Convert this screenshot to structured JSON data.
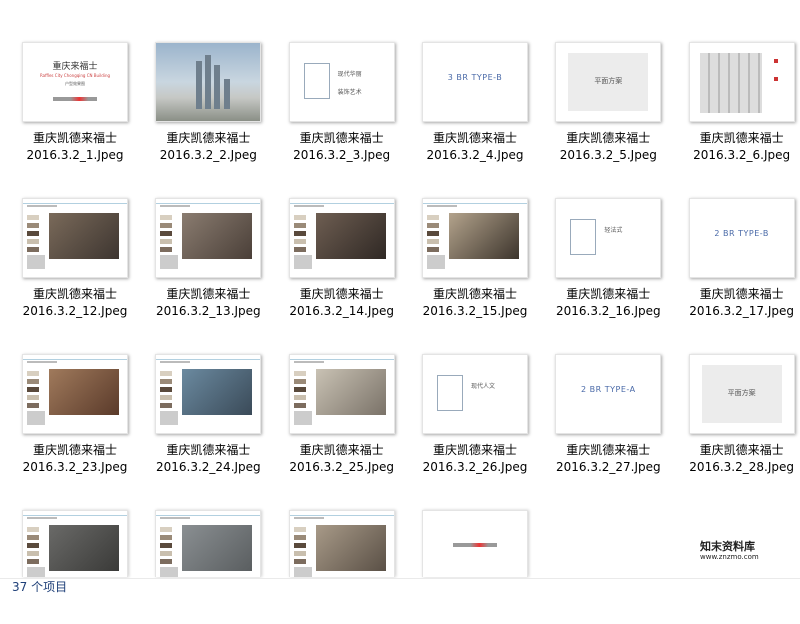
{
  "files": [
    {
      "line1": "重庆凯德来福士",
      "line2": "2016.3.2_1.Jpeg",
      "kind": "cover",
      "cover_title": "重庆来福士",
      "cover_sub": "Raffles City Chongqing CN Building",
      "cover_sub2": "户型效果图"
    },
    {
      "line1": "重庆凯德来福士",
      "line2": "2016.3.2_2.Jpeg",
      "kind": "sky"
    },
    {
      "line1": "重庆凯德来福士",
      "line2": "2016.3.2_3.Jpeg",
      "kind": "txt",
      "a": "现代华丽",
      "b": "装饰艺术"
    },
    {
      "line1": "重庆凯德来福士",
      "line2": "2016.3.2_4.Jpeg",
      "kind": "title",
      "title": "3 BR TYPE-B"
    },
    {
      "line1": "重庆凯德来福士",
      "line2": "2016.3.2_5.Jpeg",
      "kind": "plan",
      "title": "平面方案"
    },
    {
      "line1": "重庆凯德来福士",
      "line2": "2016.3.2_6.Jpeg",
      "kind": "floor"
    },
    {
      "line1": "重庆凯德来福士",
      "line2": "2016.3.2_12.Jpeg",
      "kind": "room",
      "c1": "#7a6a5a",
      "c2": "#3d3530"
    },
    {
      "line1": "重庆凯德来福士",
      "line2": "2016.3.2_13.Jpeg",
      "kind": "room",
      "c1": "#8a7c70",
      "c2": "#4a3f38"
    },
    {
      "line1": "重庆凯德来福士",
      "line2": "2016.3.2_14.Jpeg",
      "kind": "room",
      "c1": "#6e5e52",
      "c2": "#2f2824"
    },
    {
      "line1": "重庆凯德来福士",
      "line2": "2016.3.2_15.Jpeg",
      "kind": "room",
      "c1": "#b3a38c",
      "c2": "#3c342c"
    },
    {
      "line1": "重庆凯德来福士",
      "line2": "2016.3.2_16.Jpeg",
      "kind": "txt",
      "a": "轻法式",
      "b": ""
    },
    {
      "line1": "重庆凯德来福士",
      "line2": "2016.3.2_17.Jpeg",
      "kind": "title",
      "title": "2 BR TYPE-B"
    },
    {
      "line1": "重庆凯德来福士",
      "line2": "2016.3.2_23.Jpeg",
      "kind": "room",
      "c1": "#a07a5c",
      "c2": "#5a3a2a"
    },
    {
      "line1": "重庆凯德来福士",
      "line2": "2016.3.2_24.Jpeg",
      "kind": "room",
      "c1": "#6b8aa0",
      "c2": "#3a4a58"
    },
    {
      "line1": "重庆凯德来福士",
      "line2": "2016.3.2_25.Jpeg",
      "kind": "room",
      "c1": "#c9c2b4",
      "c2": "#7a7268"
    },
    {
      "line1": "重庆凯德来福士",
      "line2": "2016.3.2_26.Jpeg",
      "kind": "txt",
      "a": "现代人文",
      "b": ""
    },
    {
      "line1": "重庆凯德来福士",
      "line2": "2016.3.2_27.Jpeg",
      "kind": "title",
      "title": "2 BR TYPE-A"
    },
    {
      "line1": "重庆凯德来福士",
      "line2": "2016.3.2_28.Jpeg",
      "kind": "plan",
      "title": "平面方案"
    },
    {
      "line1": "",
      "line2": "",
      "kind": "room",
      "partial": true,
      "c1": "#6a6a68",
      "c2": "#3a3a38"
    },
    {
      "line1": "",
      "line2": "",
      "kind": "room",
      "partial": true,
      "c1": "#8a8f92",
      "c2": "#5a5e60"
    },
    {
      "line1": "",
      "line2": "",
      "kind": "room",
      "partial": true,
      "c1": "#a89a88",
      "c2": "#5a5046"
    },
    {
      "line1": "",
      "line2": "",
      "kind": "endlogo",
      "partial": true
    }
  ],
  "watermark": {
    "line1": "知末资料库",
    "line2": "www.znzmo.com"
  },
  "status": {
    "item_count": "37 个项目"
  }
}
